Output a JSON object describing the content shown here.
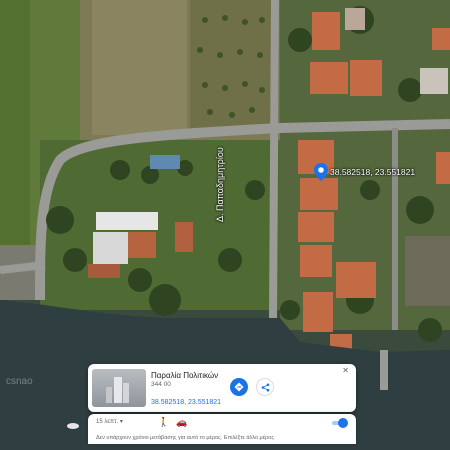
{
  "map": {
    "pin_coords_label": "38.582518, 23.551821",
    "road_label": "Δ. Παπαδημητρίου",
    "watermark": "csnao"
  },
  "place_card": {
    "title": "Παραλία Πολιτικών",
    "subtitle": "344 00",
    "coordinates": "38.582518, 23.551821",
    "close_glyph": "✕",
    "directions_icon": "directions-icon",
    "share_icon": "share-icon"
  },
  "transit_bar": {
    "time_select": "15 λεπτ. ▾",
    "walk_icon": "🚶",
    "car_icon": "🚗",
    "message": "Δεν υπάρχουν χρόνοι μετάβασης για αυτό το μέρος. Επιλέξτε άλλο μέρος"
  },
  "colors": {
    "water": "#2f3e40",
    "accent": "#1a73e8",
    "road": "#9a9a96"
  }
}
